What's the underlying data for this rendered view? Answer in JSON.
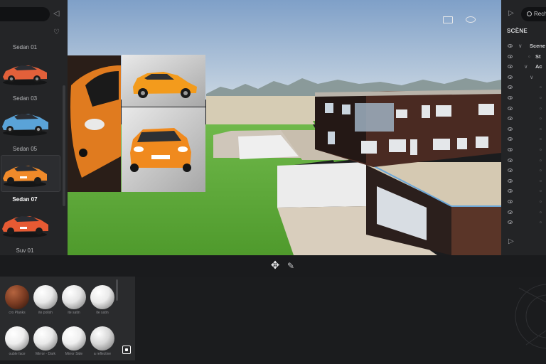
{
  "left_panel": {
    "cars": [
      {
        "label": "Sedan 01",
        "color": "#e2603a"
      },
      {
        "label": "Sedan 03",
        "color": "#5aa3d8"
      },
      {
        "label": "Sedan 05",
        "color": "#f08a2a"
      },
      {
        "label": "Sedan 07",
        "color": "#e65a33"
      },
      {
        "label": "Suv 01",
        "color": "#a0a0a0"
      }
    ],
    "selected_index": 2,
    "heart_icon": "heart-icon",
    "collapse_icon": "chevron-left-icon"
  },
  "right_panel": {
    "search_placeholder": "Rech",
    "scene_title": "SCÈNE",
    "tree": [
      {
        "label": "Scene",
        "indent": 0,
        "arrow": "down"
      },
      {
        "label": "St",
        "indent": 1,
        "arrow": ""
      },
      {
        "label": "Ac",
        "indent": 1,
        "arrow": "down"
      },
      {
        "label": "",
        "indent": 2,
        "arrow": "down"
      },
      {
        "label": "",
        "indent": 3,
        "arrow": ""
      },
      {
        "label": "",
        "indent": 3,
        "arrow": ""
      },
      {
        "label": "",
        "indent": 3,
        "arrow": ""
      },
      {
        "label": "",
        "indent": 3,
        "arrow": ""
      },
      {
        "label": "",
        "indent": 3,
        "arrow": ""
      },
      {
        "label": "",
        "indent": 3,
        "arrow": ""
      },
      {
        "label": "",
        "indent": 3,
        "arrow": ""
      },
      {
        "label": "",
        "indent": 3,
        "arrow": ""
      },
      {
        "label": "",
        "indent": 3,
        "arrow": ""
      },
      {
        "label": "",
        "indent": 3,
        "arrow": ""
      },
      {
        "label": "",
        "indent": 3,
        "arrow": ""
      },
      {
        "label": "",
        "indent": 3,
        "arrow": ""
      },
      {
        "label": "",
        "indent": 3,
        "arrow": ""
      },
      {
        "label": "",
        "indent": 3,
        "arrow": ""
      }
    ]
  },
  "toolbar": {
    "move_icon": "move-arrows-icon",
    "brush_icon": "paint-brush-icon"
  },
  "materials": [
    {
      "label": "cro Planks",
      "color": "#7a3b22"
    },
    {
      "label": "ite polish",
      "color": "#e8e8e8"
    },
    {
      "label": "ite satin",
      "color": "#e4e4e4"
    },
    {
      "label": "ite satin",
      "color": "#eaeaea"
    },
    {
      "label": "ouble face",
      "color": "#eeeeee"
    },
    {
      "label": "Mirror - Dark",
      "color": "#e9e9e9"
    },
    {
      "label": "Mirror Side",
      "color": "#efefef"
    },
    {
      "label": "a reflective",
      "color": "#d8d8d8"
    }
  ],
  "viewport": {
    "sky_top": "#7fa0c8",
    "grass": "#5fab3a",
    "building_wood": "#4a2a22",
    "car_orange": "#f08a1e"
  }
}
